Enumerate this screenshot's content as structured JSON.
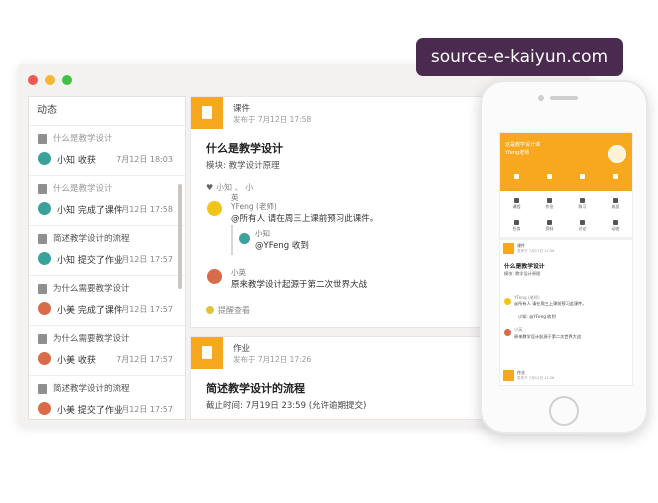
{
  "watermark": "source-e-kaiyun.com",
  "sidebar": {
    "title": "动态",
    "items": [
      {
        "course": "什么是教学设计",
        "user": "小知 收获",
        "time": "7月12日 18:03"
      },
      {
        "course": "什么是教学设计",
        "user": "小知 完成了课件",
        "time": "7月12日 17:58"
      },
      {
        "course": "简述教学设计的流程",
        "user": "小知 提交了作业",
        "time": "7月12日 17:57"
      },
      {
        "course": "为什么需要教学设计",
        "user": "小美 完成了课件",
        "time": "7月12日 17:57"
      },
      {
        "course": "为什么需要教学设计",
        "user": "小美 收获",
        "time": "7月12日 17:57"
      },
      {
        "course": "简述教学设计的流程",
        "user": "小美 提交了作业",
        "time": "7月12日 17:57"
      }
    ]
  },
  "card1": {
    "type": "课件",
    "meta": "发布于 7月12日 17:58",
    "title": "什么是教学设计",
    "module": "模块: 教学设计原理",
    "likes": "小知 、 小",
    "likes2": "英",
    "comment1_name": "YFeng (老师)",
    "comment1_text": "@所有人 请在周三上课前预习此课件。",
    "reply_name": "小知",
    "reply_text": "@YFeng 收到",
    "comment2_name": "小英",
    "comment2_text": "原来教学设计起源于第二次世界大战",
    "remind": "提醒查看"
  },
  "card2": {
    "type": "作业",
    "meta": "发布于 7月12日 17:26",
    "title": "简述教学设计的流程",
    "due": "截止时间: 7月19日 23:59 (允许逾期提交)"
  },
  "phone": {
    "header_line1": "这是教学设计课",
    "header_line2": "Yfeng老师",
    "grid": [
      {
        "icon": "student-icon",
        "label": "课程"
      },
      {
        "icon": "doc-icon",
        "label": "作业"
      },
      {
        "icon": "practice-icon",
        "label": "练习"
      },
      {
        "icon": "people-icon",
        "label": "成员"
      },
      {
        "icon": "sound-icon",
        "label": "任务"
      },
      {
        "icon": "file-icon",
        "label": "资料"
      },
      {
        "icon": "chat-icon",
        "label": "讨论"
      },
      {
        "icon": "clock-icon",
        "label": "动态"
      }
    ],
    "card_type": "课件",
    "card_meta": "发布于 7月12日 17:58",
    "card_title": "什么是教学设计",
    "card_module": "模块: 教学设计原理",
    "c_name": "YFeng (老师)",
    "c_text": "@所有人 请在周三上课前预习此课件。",
    "r_text": "小知: @YFeng 收到",
    "c2_name": "小英",
    "c2_text": "原来教学设计起源于第二次世界大战",
    "card2_type": "作业",
    "card2_meta": "发布于 7月12日 17:26"
  }
}
